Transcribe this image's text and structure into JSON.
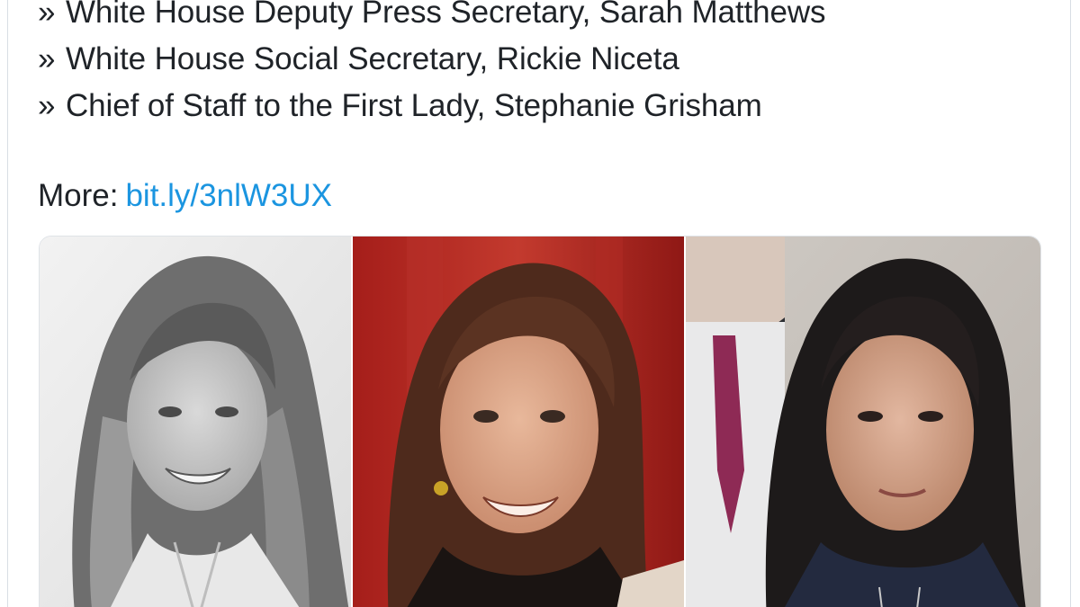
{
  "tweet": {
    "lines": [
      {
        "bullet": "»",
        "text": "White House Deputy Press Secretary, Sarah Matthews"
      },
      {
        "bullet": "»",
        "text": "White House Social Secretary, Rickie Niceta"
      },
      {
        "bullet": "»",
        "text": "Chief of Staff to the First Lady, Stephanie Grisham"
      }
    ],
    "more_label": "More:",
    "more_link": "bit.ly/3nlW3UX"
  },
  "colors": {
    "link": "#1b95e0",
    "text": "#1f2328",
    "border": "#d8dee4"
  },
  "media": {
    "photos": [
      {
        "icon": "portrait-photo"
      },
      {
        "icon": "portrait-photo"
      },
      {
        "icon": "portrait-photo"
      }
    ]
  }
}
